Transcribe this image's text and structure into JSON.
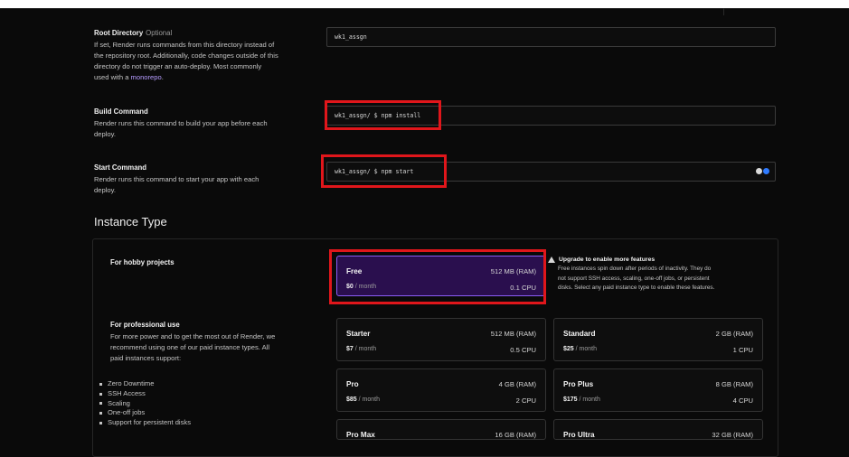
{
  "root_directory": {
    "title": "Root Directory",
    "optional": "Optional",
    "desc_lines": [
      "If set, Render runs commands from this directory instead of",
      "the repository root. Additionally, code changes outside of this",
      "directory do not trigger an auto-deploy. Most commonly"
    ],
    "desc_tail_prefix": "used with a ",
    "desc_link": "monorepo",
    "desc_tail_suffix": ".",
    "value": "wk1_assgn"
  },
  "build_command": {
    "title": "Build Command",
    "desc_lines": [
      "Render runs this command to build your app before each",
      "deploy."
    ],
    "value": "wk1_assgn/ $ npm install"
  },
  "start_command": {
    "title": "Start Command",
    "desc_lines": [
      "Render runs this command to start your app with each",
      "deploy."
    ],
    "value": "wk1_assgn/ $ npm start"
  },
  "instance_type": {
    "heading": "Instance Type",
    "hobby_title": "For hobby projects",
    "pro_title": "For professional use",
    "pro_desc_lines": [
      "For more power and to get the most out of Render, we",
      "recommend using one of our paid instance types. All",
      "paid instances support:"
    ],
    "features": [
      "Zero Downtime",
      "SSH Access",
      "Scaling",
      "One-off jobs",
      "Support for persistent disks"
    ],
    "upgrade": {
      "title": "Upgrade to enable more features",
      "desc_lines": [
        "Free instances spin down after periods of inactivity. They do",
        "not support SSH access, scaling, one-off jobs, or persistent",
        "disks. Select any paid instance type to enable these features."
      ]
    },
    "free": {
      "name": "Free",
      "price": "$0",
      "period": " / month",
      "ram": "512 MB (RAM)",
      "cpu": "0.1 CPU"
    },
    "plans": [
      {
        "name": "Starter",
        "price": "$7",
        "period": " / month",
        "ram": "512 MB (RAM)",
        "cpu": "0.5 CPU"
      },
      {
        "name": "Standard",
        "price": "$25",
        "period": " / month",
        "ram": "2 GB (RAM)",
        "cpu": "1 CPU"
      },
      {
        "name": "Pro",
        "price": "$85",
        "period": " / month",
        "ram": "4 GB (RAM)",
        "cpu": "2 CPU"
      },
      {
        "name": "Pro Plus",
        "price": "$175",
        "period": " / month",
        "ram": "8 GB (RAM)",
        "cpu": "4 CPU"
      },
      {
        "name": "Pro Max",
        "price": "",
        "period": "",
        "ram": "16 GB (RAM)",
        "cpu": ""
      },
      {
        "name": "Pro Ultra",
        "price": "",
        "period": "",
        "ram": "32 GB (RAM)",
        "cpu": ""
      }
    ]
  },
  "colors": {
    "accent": "#2a0f4e",
    "highlight": "#e0161b"
  },
  "icons": {
    "secret": "secret-file-icon",
    "warning": "warning-icon"
  }
}
